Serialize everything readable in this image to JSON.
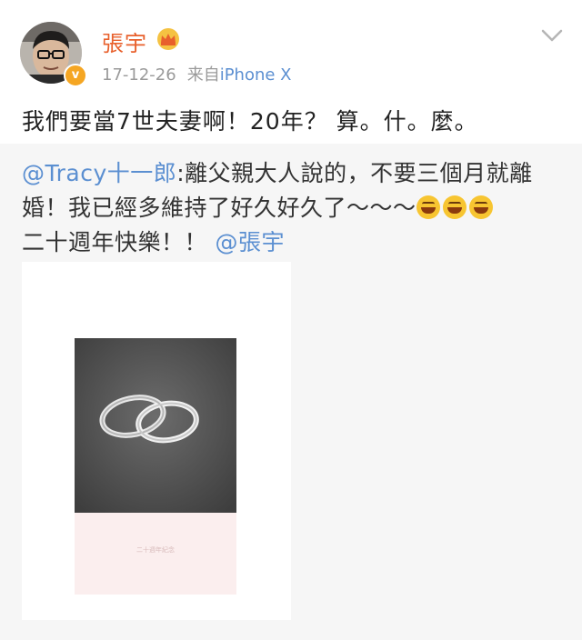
{
  "user": {
    "name": "張宇",
    "time": "17-12-26",
    "source_prefix": "来自",
    "device": "iPhone X"
  },
  "post": {
    "text": "我們要當7世夫妻啊！20年？ 算。什。麼。"
  },
  "repost": {
    "mention_user": "@Tracy十一郎",
    "text_part1": ":離父親大人說的，不要三個月就離婚！我已經多維持了好久好久了～～～",
    "emoji_name": "rofl-emoji",
    "text_part2": "二十週年快樂！！",
    "mention_end": "@張宇",
    "image_caption": "二十週年紀念"
  },
  "colors": {
    "username": "#e8602c",
    "link": "#5b8fd1",
    "verified": "#f5a623",
    "repost_bg": "#f6f6f6"
  },
  "icons": {
    "crown": "crown-icon",
    "verified": "verified-badge-icon",
    "menu": "chevron-down-icon"
  }
}
